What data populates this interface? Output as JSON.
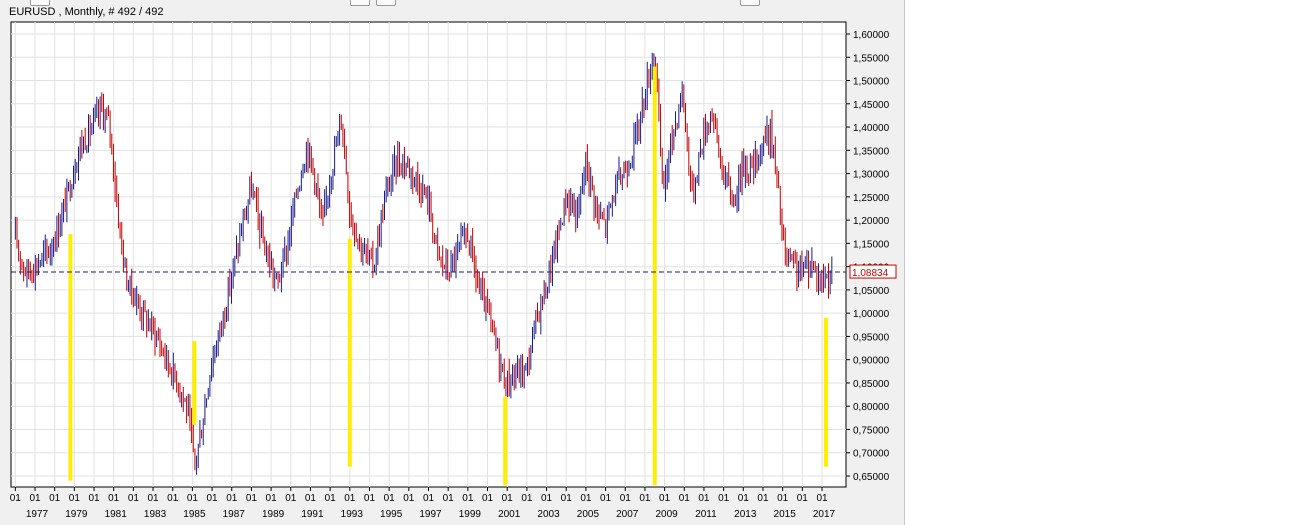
{
  "window": {
    "title": "EURUSD , Monthly, # 492 / 492"
  },
  "colors": {
    "up_candle": "#1a1a8c",
    "down_candle": "#c00000",
    "marker": "#ffee00",
    "grid": "#e2e2e2",
    "last_line": "#1a1a8c",
    "last_box": "#d00000"
  },
  "chart_data": {
    "type": "candlestick",
    "symbol": "EURUSD",
    "timeframe": "Monthly",
    "bars_shown": 492,
    "bars_total": 492,
    "title": "EURUSD , Monthly, # 492 / 492",
    "ylim": [
      0.63,
      1.62
    ],
    "xlim": [
      1976.0,
      2017.65
    ],
    "grid": true,
    "y_ticks": [
      "1,60000",
      "1,55000",
      "1,50000",
      "1,45000",
      "1,40000",
      "1,35000",
      "1,30000",
      "1,25000",
      "1,20000",
      "1,15000",
      "1,10000",
      "1,05000",
      "1,00000",
      "0,95000",
      "0,90000",
      "0,85000",
      "0,80000",
      "0,75000",
      "0,70000",
      "0,65000"
    ],
    "y_tick_values": [
      1.6,
      1.55,
      1.5,
      1.45,
      1.4,
      1.35,
      1.3,
      1.25,
      1.2,
      1.15,
      1.1,
      1.05,
      1.0,
      0.95,
      0.9,
      0.85,
      0.8,
      0.75,
      0.7,
      0.65
    ],
    "x_month_label": "01",
    "x_month_ticks": [
      1976,
      1977,
      1978,
      1979,
      1980,
      1981,
      1982,
      1983,
      1984,
      1985,
      1986,
      1987,
      1988,
      1989,
      1990,
      1991,
      1992,
      1993,
      1994,
      1995,
      1996,
      1997,
      1998,
      1999,
      2000,
      2001,
      2002,
      2003,
      2004,
      2005,
      2006,
      2007,
      2008,
      2009,
      2010,
      2011,
      2012,
      2013,
      2014,
      2015,
      2016,
      2017
    ],
    "x_year_labels": [
      "1977",
      "1979",
      "1981",
      "1983",
      "1985",
      "1987",
      "1989",
      "1991",
      "1993",
      "1995",
      "1997",
      "1999",
      "2001",
      "2003",
      "2005",
      "2007",
      "2009",
      "2011",
      "2013",
      "2015",
      "2017"
    ],
    "x_year_values": [
      1977,
      1979,
      1981,
      1983,
      1985,
      1987,
      1989,
      1991,
      1993,
      1995,
      1997,
      1999,
      2001,
      2003,
      2005,
      2007,
      2009,
      2011,
      2013,
      2015,
      2017
    ],
    "price_path": [
      [
        1976.0,
        1.16
      ],
      [
        1976.5,
        1.09
      ],
      [
        1977.0,
        1.1
      ],
      [
        1977.8,
        1.14
      ],
      [
        1978.3,
        1.2
      ],
      [
        1978.8,
        1.28
      ],
      [
        1979.2,
        1.35
      ],
      [
        1979.9,
        1.4
      ],
      [
        1980.4,
        1.44
      ],
      [
        1980.8,
        1.4
      ],
      [
        1981.2,
        1.22
      ],
      [
        1981.6,
        1.08
      ],
      [
        1982.0,
        1.04
      ],
      [
        1982.6,
        0.99
      ],
      [
        1983.2,
        0.95
      ],
      [
        1983.8,
        0.89
      ],
      [
        1984.4,
        0.84
      ],
      [
        1984.8,
        0.78
      ],
      [
        1985.1,
        0.67
      ],
      [
        1985.5,
        0.76
      ],
      [
        1985.9,
        0.88
      ],
      [
        1986.5,
        0.98
      ],
      [
        1987.0,
        1.08
      ],
      [
        1987.6,
        1.2
      ],
      [
        1988.0,
        1.27
      ],
      [
        1988.6,
        1.15
      ],
      [
        1989.3,
        1.06
      ],
      [
        1989.8,
        1.14
      ],
      [
        1990.3,
        1.26
      ],
      [
        1990.8,
        1.36
      ],
      [
        1991.2,
        1.3
      ],
      [
        1991.6,
        1.18
      ],
      [
        1992.0,
        1.3
      ],
      [
        1992.6,
        1.42
      ],
      [
        1993.0,
        1.22
      ],
      [
        1993.6,
        1.14
      ],
      [
        1994.2,
        1.1
      ],
      [
        1994.8,
        1.25
      ],
      [
        1995.4,
        1.33
      ],
      [
        1995.9,
        1.32
      ],
      [
        1996.5,
        1.28
      ],
      [
        1997.0,
        1.24
      ],
      [
        1997.5,
        1.12
      ],
      [
        1998.0,
        1.09
      ],
      [
        1998.6,
        1.14
      ],
      [
        1999.0,
        1.17
      ],
      [
        1999.5,
        1.06
      ],
      [
        2000.0,
        1.0
      ],
      [
        2000.5,
        0.92
      ],
      [
        2000.9,
        0.85
      ],
      [
        2001.5,
        0.87
      ],
      [
        2002.0,
        0.88
      ],
      [
        2002.5,
        0.99
      ],
      [
        2003.0,
        1.06
      ],
      [
        2003.5,
        1.15
      ],
      [
        2004.0,
        1.25
      ],
      [
        2004.6,
        1.21
      ],
      [
        2005.0,
        1.33
      ],
      [
        2005.6,
        1.21
      ],
      [
        2006.0,
        1.19
      ],
      [
        2006.5,
        1.27
      ],
      [
        2007.0,
        1.31
      ],
      [
        2007.5,
        1.37
      ],
      [
        2008.0,
        1.47
      ],
      [
        2008.5,
        1.57
      ],
      [
        2008.9,
        1.26
      ],
      [
        2009.4,
        1.38
      ],
      [
        2009.9,
        1.48
      ],
      [
        2010.4,
        1.25
      ],
      [
        2010.9,
        1.37
      ],
      [
        2011.4,
        1.44
      ],
      [
        2011.9,
        1.31
      ],
      [
        2012.5,
        1.24
      ],
      [
        2013.0,
        1.32
      ],
      [
        2013.5,
        1.31
      ],
      [
        2014.0,
        1.37
      ],
      [
        2014.4,
        1.39
      ],
      [
        2014.8,
        1.25
      ],
      [
        2015.1,
        1.12
      ],
      [
        2015.5,
        1.1
      ],
      [
        2016.0,
        1.09
      ],
      [
        2016.5,
        1.11
      ],
      [
        2016.9,
        1.07
      ],
      [
        2017.2,
        1.08
      ],
      [
        2017.5,
        1.09
      ]
    ],
    "current_price": 1.08834,
    "current_price_label": "1,08834",
    "markers": [
      {
        "x": 1978.8,
        "ymin": 0.64,
        "ymax": 1.17
      },
      {
        "x": 1985.1,
        "ymin": 0.76,
        "ymax": 0.94
      },
      {
        "x": 1993.0,
        "ymin": 0.67,
        "ymax": 1.16
      },
      {
        "x": 2000.9,
        "ymin": 0.63,
        "ymax": 0.82
      },
      {
        "x": 2008.5,
        "ymin": 0.63,
        "ymax": 1.53
      },
      {
        "x": 2017.2,
        "ymin": 0.67,
        "ymax": 0.99
      }
    ]
  }
}
